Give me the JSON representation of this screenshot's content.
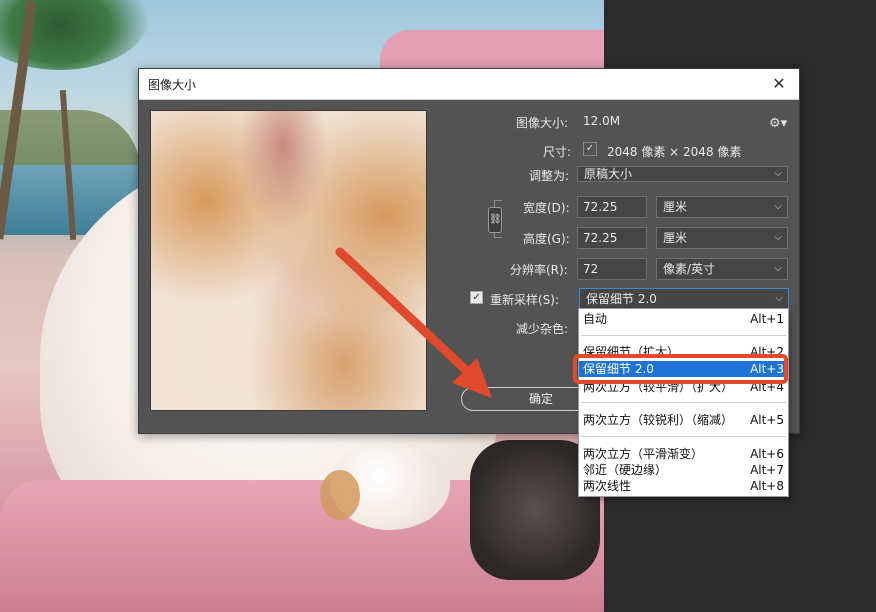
{
  "window": {
    "title": "图像大小",
    "close_label": "✕"
  },
  "image_size": {
    "label": "图像大小:",
    "value": "12.0M"
  },
  "dimensions": {
    "label": "尺寸:",
    "value": "2048 像素  ×  2048 像素"
  },
  "fit_to": {
    "label": "调整为:",
    "value": "原稿大小"
  },
  "width": {
    "label": "宽度(D):",
    "value": "72.25",
    "unit": "厘米"
  },
  "height": {
    "label": "高度(G):",
    "value": "72.25",
    "unit": "厘米"
  },
  "resolution": {
    "label": "分辨率(R):",
    "value": "72",
    "unit": "像素/英寸"
  },
  "resample": {
    "label": "重新采样(S):",
    "value": "保留细节 2.0",
    "checked": true
  },
  "reduce_noise": {
    "label": "减少杂色:"
  },
  "ok_label": "确定",
  "icons": {
    "gear": "gear-icon",
    "link": "chain-link-icon",
    "chevron": "chevron-down-icon"
  },
  "dropdown": {
    "items": [
      {
        "label": "自动",
        "shortcut": "Alt+1"
      },
      {
        "label": "保留细节（扩大）",
        "shortcut": "Alt+2"
      },
      {
        "label": "保留细节 2.0",
        "shortcut": "Alt+3",
        "selected": true
      },
      {
        "label": "两次立方（较平滑）（扩大）",
        "shortcut": "Alt+4"
      },
      {
        "label": "两次立方（较锐利）（缩减）",
        "shortcut": "Alt+5"
      },
      {
        "label": "两次立方（平滑渐变）",
        "shortcut": "Alt+6"
      },
      {
        "label": "邻近（硬边缘）",
        "shortcut": "Alt+7"
      },
      {
        "label": "两次线性",
        "shortcut": "Alt+8"
      }
    ]
  },
  "colors": {
    "dialog_bg": "#535353",
    "selection": "#1e73d6",
    "annotation": "#e0492c"
  }
}
